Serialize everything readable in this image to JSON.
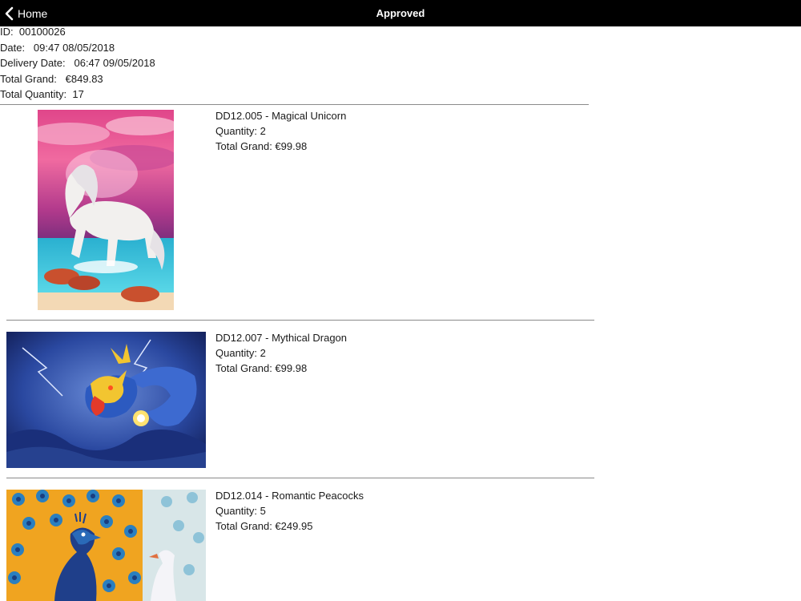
{
  "navbar": {
    "back_label": "Home",
    "title": "Approved"
  },
  "order": {
    "id_label": "ID:",
    "id_value": "00100026",
    "date_label": "Date:",
    "date_value": "09:47 08/05/2018",
    "delivery_label": "Delivery Date:",
    "delivery_value": "06:47 09/05/2018",
    "total_grand_label": "Total Grand:",
    "total_grand_value": "€849.83",
    "total_qty_label": "Total Quantity:",
    "total_qty_value": "17"
  },
  "items": [
    {
      "title": "DD12.005 - Magical Unicorn",
      "quantity": "Quantity: 2",
      "total": "Total Grand: €99.98",
      "image": "unicorn-artwork"
    },
    {
      "title": "DD12.007 - Mythical Dragon",
      "quantity": "Quantity: 2",
      "total": "Total Grand: €99.98",
      "image": "dragon-artwork"
    },
    {
      "title": "DD12.014 - Romantic Peacocks",
      "quantity": "Quantity: 5",
      "total": "Total Grand: €249.95",
      "image": "peacock-artwork"
    }
  ]
}
